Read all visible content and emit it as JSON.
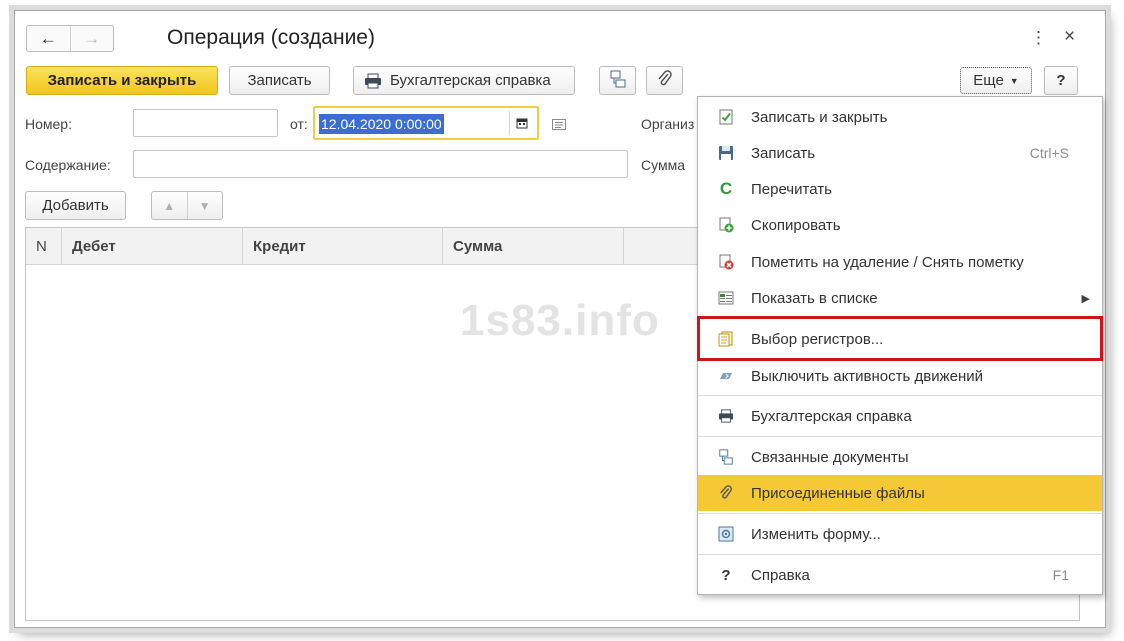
{
  "window": {
    "title": "Операция (создание)",
    "nav_back": "←",
    "nav_forward": "→",
    "more_dots": "⋮",
    "close": "×"
  },
  "toolbar": {
    "save_close": "Записать и закрыть",
    "save": "Записать",
    "report": "Бухгалтерская справка",
    "more": "Еще",
    "help": "?"
  },
  "form": {
    "number_label": "Номер:",
    "number_value": "",
    "from_label": "от:",
    "date_value": "12.04.2020  0:00:00",
    "org_label": "Организ",
    "content_label": "Содержание:",
    "content_value": "",
    "sum_label": "Сумма"
  },
  "table": {
    "add_button": "Добавить",
    "columns": [
      "N",
      "Дебет",
      "Кредит",
      "Сумма"
    ]
  },
  "watermark": "1s83.info",
  "menu": {
    "items": [
      {
        "label": "Записать и закрыть",
        "icon": "check-doc-icon",
        "color": "#3aa53a"
      },
      {
        "label": "Записать",
        "icon": "floppy-icon",
        "shortcut": "Ctrl+S",
        "color": "#4a6a8c"
      },
      {
        "label": "Перечитать",
        "icon": "refresh-icon",
        "color": "#2e9c3c"
      },
      {
        "label": "Скопировать",
        "icon": "copy-icon",
        "color": "#3aa53a"
      },
      {
        "label": "Пометить на удаление / Снять пометку",
        "icon": "delete-mark-icon",
        "color": "#d23b2b"
      },
      {
        "label": "Показать в списке",
        "icon": "list-icon",
        "color": "#4a7a4a"
      },
      {
        "label": "Выбор регистров...",
        "icon": "registers-icon",
        "color": "#d9a21b"
      },
      {
        "label": "Выключить активность движений",
        "icon": "toggle-activity-icon",
        "color": "#7ea3c6"
      },
      {
        "label": "Бухгалтерская справка",
        "icon": "printer-icon",
        "color": "#444"
      },
      {
        "label": "Связанные документы",
        "icon": "linked-docs-icon",
        "color": "#4a6a8c"
      },
      {
        "label": "Присоединенные файлы",
        "icon": "paperclip-icon",
        "color": "#555"
      },
      {
        "label": "Изменить форму...",
        "icon": "change-form-icon",
        "color": "#4a7aa0"
      },
      {
        "label": "Справка",
        "icon": "help-icon",
        "shortcut": "F1",
        "color": "#333"
      }
    ],
    "highlight_color": "#f4c935",
    "callout_color": "#d0121b"
  },
  "colors": {
    "primary_button": "#f2c61f",
    "selection": "#3a6fd1",
    "focus_border": "#f1cd46"
  }
}
